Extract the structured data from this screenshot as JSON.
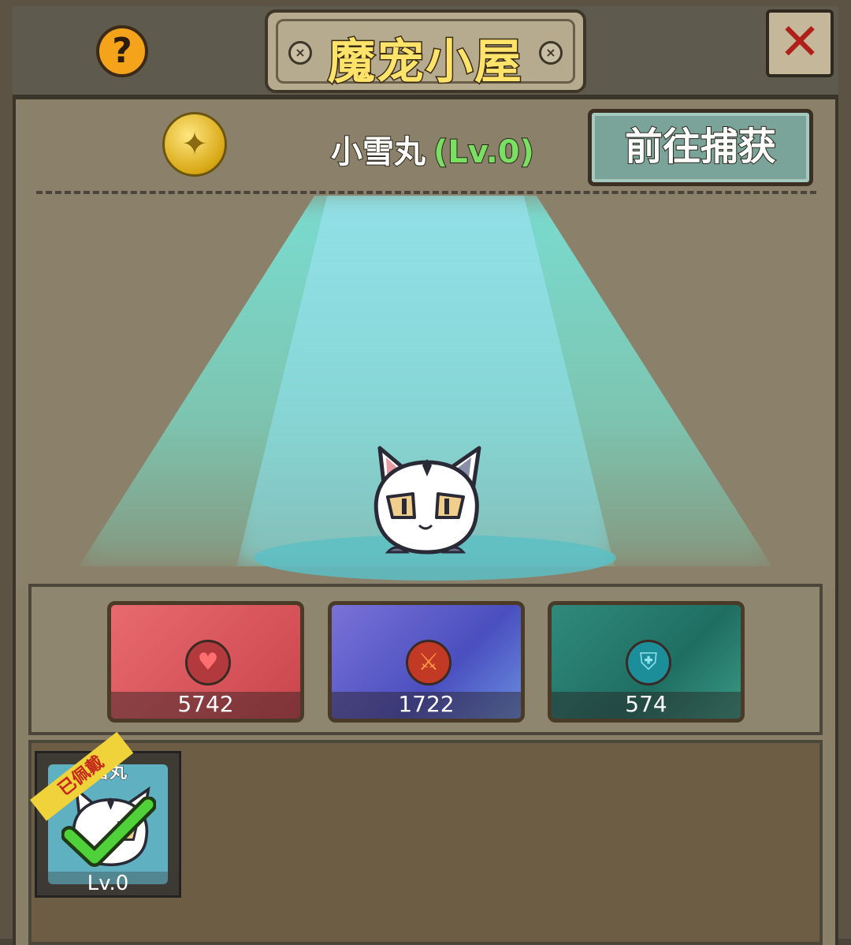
{
  "header": {
    "title": "魔宠小屋",
    "help_icon": "question-icon",
    "close_icon": "close-icon"
  },
  "pet": {
    "name": "小雪丸",
    "level_label": "(Lv.0)",
    "capture_button": "前往捕获"
  },
  "stats": [
    {
      "icon": "heart-icon",
      "value": "5742"
    },
    {
      "icon": "sword-icon",
      "value": "1722"
    },
    {
      "icon": "shield-icon",
      "value": "574"
    }
  ],
  "collection": {
    "slots": [
      {
        "name": "雪丸",
        "level": "Lv.0",
        "badge": "已佩戴",
        "equipped": true
      }
    ]
  },
  "colors": {
    "title_text": "#ffe36a",
    "level_text": "#79e063",
    "capture_button_bg": "#7aa39a",
    "close_x": "#b0201a"
  }
}
